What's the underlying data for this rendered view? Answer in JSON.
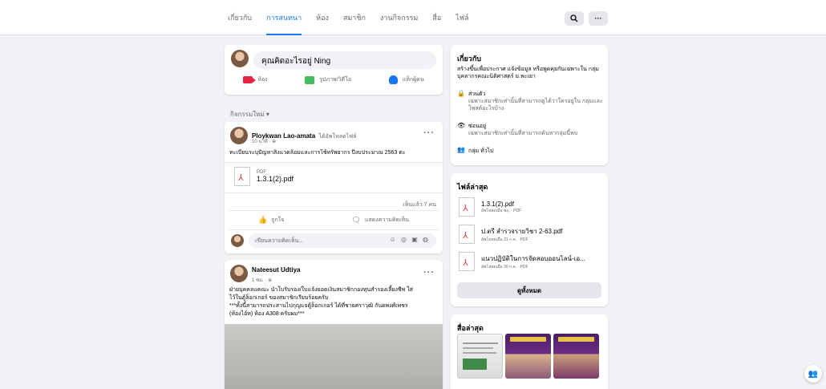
{
  "nav": {
    "tabs": [
      {
        "label": "เกี่ยวกับ"
      },
      {
        "label": "การสนทนา"
      },
      {
        "label": "ห้อง"
      },
      {
        "label": "สมาชิก"
      },
      {
        "label": "งานกิจกรรม"
      },
      {
        "label": "สื่อ"
      },
      {
        "label": "ไฟล์"
      }
    ],
    "active_tab": "การสนทนา",
    "search_icon": "search-icon",
    "more_icon": "more-icon",
    "more_label": "···",
    "search_label": "🔍"
  },
  "composer": {
    "placeholder": "คุณคิดอะไรอยู่ Ning",
    "actions": [
      {
        "label": "ห้อง",
        "icon": "video-room-icon"
      },
      {
        "label": "รูปภาพ/วิดีโอ",
        "icon": "photo-icon"
      },
      {
        "label": "แท็กผู้คน",
        "icon": "tag-people-icon"
      }
    ]
  },
  "feed": {
    "section_label": "กิจกรรมใหม่ ▾"
  },
  "post1": {
    "author": "Ploykwan Lao-amata",
    "action": "ได้อัพโหลดไฟล์",
    "time": "10 นาที · ⊕",
    "text": "ทะเบียนระบุปัญหาสิ่งแวดล้อมและการใช้ทรัพยากร ปีงบประมาณ 2563 ตะ",
    "file_type": "PDF",
    "file_name": "1.3.1(2).pdf",
    "seen": "เห็นแล้ว 7 คน",
    "like_label": "ถูกใจ",
    "comment_label": "แสดงความคิดเห็น",
    "comment_placeholder": "เขียนความคิดเห็น...",
    "comment_icons": "☺ ◎ ▣ ◍",
    "more_label": "···"
  },
  "post2": {
    "author": "Nateesut Udtiya",
    "time": "1 ชม. · ⊕",
    "text_lines": [
      "ฝ่ายบุคคลแคณะ นำใบรับรอง/ใบแจ้งยอดเงินสมาชิกกองทุนสำรองเลี้ยงชีพ ใส่",
      "ไว้ในตู้ล็อกเกอร์ ของสมาชิกเรียบร้อยครับ",
      "***ทั้งนี้สามารถประสานไปกุญแจตู้ล็อกเกอร์ ได้ที่ชายศราวุฒิ กันดพงศ์เพชร",
      "(ห้องไอ้ห) ห้อง A308 ครับผม***"
    ],
    "more_label": "···"
  },
  "about": {
    "title": "เกี่ยวกับ",
    "description": "สร้างขึ้นเพื่อประกาศ แจ้งข้อมูล หรือพูดคุยกันเฉพาะใน กลุ่มบุคลากรคณะนิติศาสตร์ ม.พะเยา",
    "privacy_title": "ส่วนตัว",
    "privacy_desc": "เฉพาะสมาชิกเท่านั้นที่สามารถดูได้ว่าใครอยู่ใน กลุ่มและโพสต์อะไรบ้าง",
    "visible_title": "ซ่อนอยู่",
    "visible_desc": "เฉพาะสมาชิกเท่านั้นที่สามารถค้นหากลุ่มนี้พบ",
    "group_type": "กลุ่ม ทั่วไป"
  },
  "files": {
    "title": "ไฟล์ล่าสุด",
    "items": [
      {
        "name": "1.3.1(2).pdf",
        "meta": "อัพโหลดเมื่อ พฤ. · PDF"
      },
      {
        "name": "ป.ตรี สำรวจรายวิชา 2-63.pdf",
        "meta": "อัพโหลดเมื่อ 31 ก.ค. · PDF"
      },
      {
        "name": "แนวปฏิบัติในการจัดสอบออนไลน์-เอ...",
        "meta": "อัพโหลดเมื่อ 30 ก.ค. · PDF"
      }
    ],
    "see_all": "ดูทั้งหมด"
  },
  "media": {
    "title": "สื่อล่าสุด"
  },
  "colors": {
    "accent": "#1877f2",
    "pdf_red": "#e0443e",
    "background": "#f0f2f5"
  },
  "fab": {
    "icon": "people-icon",
    "label": "👥"
  }
}
